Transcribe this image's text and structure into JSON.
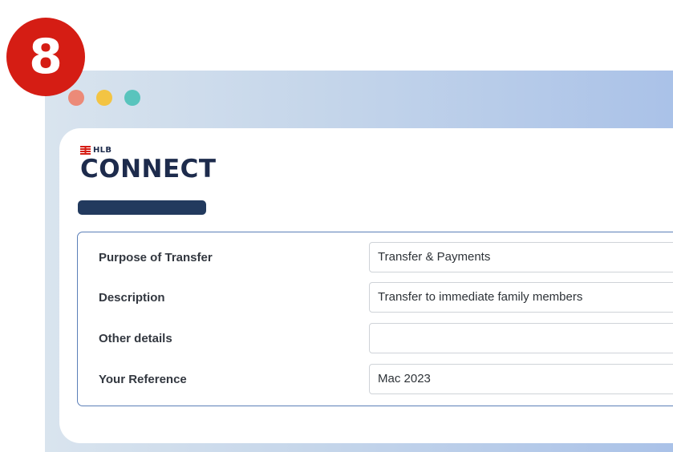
{
  "step": {
    "number": "8",
    "color": "#d51d14"
  },
  "window": {
    "traffic_lights": [
      "#ec8a78",
      "#f3c443",
      "#59c4bd"
    ]
  },
  "brand": {
    "top_label": "HLB",
    "wordmark": "CONNECT",
    "mark_icon": "hlb-logo-icon"
  },
  "form": {
    "rows": [
      {
        "label": "Purpose of Transfer",
        "value": "Transfer & Payments"
      },
      {
        "label": "Description",
        "value": "Transfer to immediate family members"
      },
      {
        "label": "Other details",
        "value": ""
      },
      {
        "label": "Your Reference",
        "value": "Mac 2023"
      }
    ]
  }
}
